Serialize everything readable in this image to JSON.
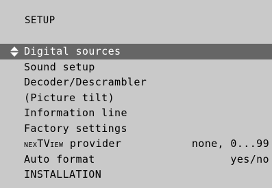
{
  "menu_title": "SETUP",
  "items": [
    {
      "label": "Digital sources",
      "value": "",
      "selected": true
    },
    {
      "label": "Sound setup",
      "value": "",
      "selected": false
    },
    {
      "label": "Decoder/Descrambler",
      "value": "",
      "selected": false
    },
    {
      "label": "(Picture tilt)",
      "value": "",
      "selected": false
    },
    {
      "label": "Information line",
      "value": "",
      "selected": false
    },
    {
      "label": "Factory settings",
      "value": "",
      "selected": false
    },
    {
      "label_prefix": "NEX",
      "label_mid": "TV",
      "label_small": "IEW",
      "label_suffix": " provider",
      "value": "none, 0...99",
      "selected": false
    },
    {
      "label": "Auto format",
      "value": "yes/no",
      "selected": false
    },
    {
      "label": "INSTALLATION",
      "value": "",
      "selected": false
    }
  ],
  "colors": {
    "screen_background": "#c9c9c9",
    "selection_bar": "#666666",
    "selected_text": "#ffffff",
    "text": "#000000"
  },
  "icons": {
    "selection_indicator": "up-down-arrows-icon"
  }
}
